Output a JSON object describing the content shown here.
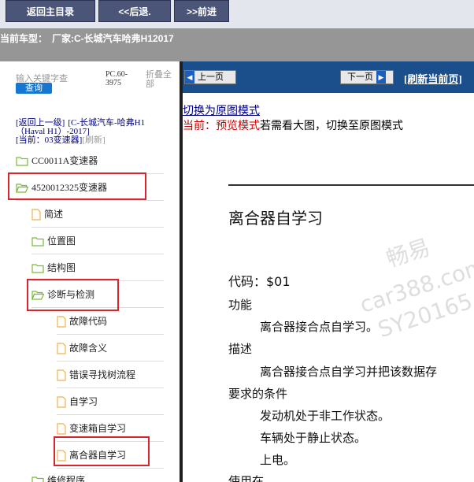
{
  "toolbar": {
    "back_main": "返回主目录",
    "back": "<<后退.",
    "forward": ">>前进"
  },
  "vehicle": {
    "label": "当前车型：",
    "value": "厂家:C-长城汽车哈弗H12017"
  },
  "sidebar": {
    "search_placeholder": "输入关键字查",
    "search_button": "查询",
    "pc_code": "PC.60-3975",
    "fold_all": "折叠全部",
    "nav_back": "[返回上一级]",
    "nav_path": "[C-长城汽车-哈弗H1（Haval H1）-2017]",
    "current": "[当前：03变速器]",
    "refresh": "[刷新]",
    "tree": [
      {
        "label": "CC0011A变速器",
        "type": "folder"
      },
      {
        "label": "4520012325变速器",
        "type": "folder-open"
      },
      {
        "label": "简述",
        "type": "doc"
      },
      {
        "label": "位置图",
        "type": "folder"
      },
      {
        "label": "结构图",
        "type": "folder"
      },
      {
        "label": "诊断与检测",
        "type": "folder-open"
      },
      {
        "label": "故障代码",
        "type": "doc"
      },
      {
        "label": "故障含义",
        "type": "doc"
      },
      {
        "label": "错误寻找树流程",
        "type": "doc"
      },
      {
        "label": "自学习",
        "type": "doc"
      },
      {
        "label": "变速箱自学习",
        "type": "doc"
      },
      {
        "label": "离合器自学习",
        "type": "doc"
      },
      {
        "label": "维修程序",
        "type": "folder"
      }
    ]
  },
  "content": {
    "prev_page": "上一页",
    "next_page": "下一页",
    "refresh_page": "[刷新当前页]",
    "switch_link": "切换为原图模式",
    "mode_current": "当前：预览模式",
    "mode_hint": "若需看大图，切换至原图模式",
    "doc_title": "离合器自学习",
    "code": "代码：$01",
    "function_title": "功能",
    "function_text": "离合器接合点自学习。",
    "desc_title": "描述",
    "desc_text": "离合器接合点自学习并把该数据存",
    "cond_title": "要求的条件",
    "cond_1": "发动机处于非工作状态。",
    "cond_2": "车辆处于静止状态。",
    "cond_3": "上电。",
    "use_title": "使用在"
  },
  "watermark": {
    "brand": "畅易",
    "site": "car388.com",
    "code": "SY20165"
  },
  "colors": {
    "toolbar_button": "#4a5577",
    "content_bar": "#1a4f8b",
    "highlight": "#d7262d",
    "folder": "#7cb93a",
    "doc": "#f2b04c"
  }
}
